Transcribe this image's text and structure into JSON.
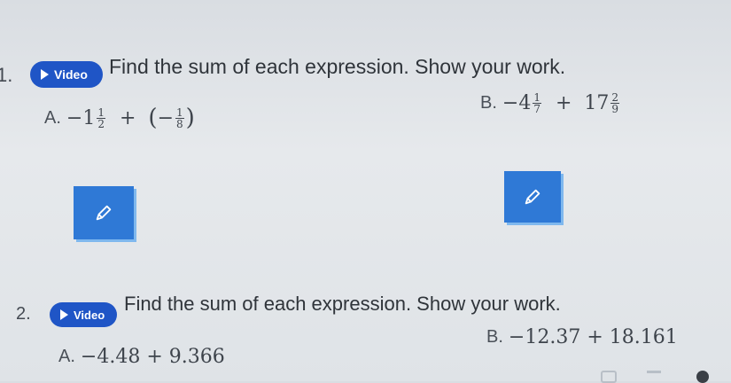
{
  "questions": [
    {
      "number": "1.",
      "video_label": "Video",
      "prompt": "Find the sum of each expression. Show your work.",
      "parts": [
        {
          "label": "A.",
          "whole_sign": "−1",
          "frac1_num": "1",
          "frac1_den": "2",
          "op": "+",
          "paren_open": "(",
          "neg": "−",
          "frac2_num": "1",
          "frac2_den": "8",
          "paren_close": ")"
        },
        {
          "label": "B.",
          "whole_sign": "−4",
          "frac1_num": "1",
          "frac1_den": "7",
          "op": "+",
          "whole2": "17",
          "frac2_num": "2",
          "frac2_den": "9"
        }
      ]
    },
    {
      "number": "2.",
      "video_label": "Video",
      "prompt": "Find the sum of each expression. Show your work.",
      "parts": [
        {
          "label": "A.",
          "expression": "−4.48 + 9.366"
        },
        {
          "label": "B.",
          "expression": "−12.37 + 18.161"
        }
      ]
    }
  ],
  "icons": {
    "edit": "pencil-icon",
    "play": "play-icon"
  },
  "colors": {
    "video_button": "#1f55c6",
    "edit_button": "#2f79d6",
    "edit_shadow": "#7fb8ee"
  }
}
